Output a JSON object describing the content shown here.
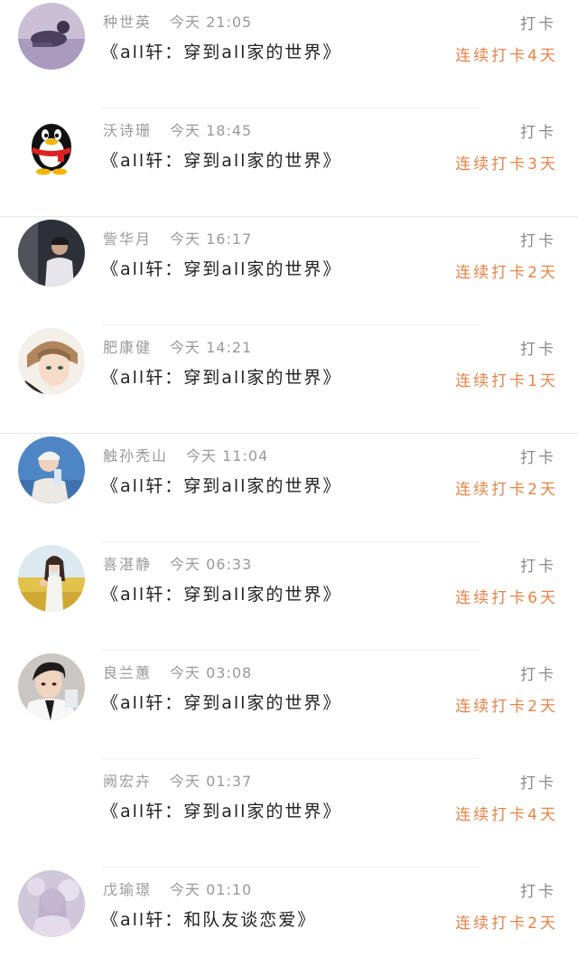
{
  "checkins": [
    {
      "user": "种世英",
      "time": "今天 21:05",
      "book": "《all轩：穿到all家的世界》",
      "action": "打卡",
      "streak": "连续打卡4天",
      "avatar_icon": "purple-photo-avatar-icon"
    },
    {
      "user": "沃诗珊",
      "time": "今天 18:45",
      "book": "《all轩：穿到all家的世界》",
      "action": "打卡",
      "streak": "连续打卡3天",
      "avatar_icon": "qq-penguin-avatar-icon"
    },
    {
      "user": "訾华月",
      "time": "今天 16:17",
      "book": "《all轩：穿到all家的世界》",
      "action": "打卡",
      "streak": "连续打卡2天",
      "avatar_icon": "dark-photo-avatar-icon"
    },
    {
      "user": "肥康健",
      "time": "今天 14:21",
      "book": "《all轩：穿到all家的世界》",
      "action": "打卡",
      "streak": "连续打卡1天",
      "avatar_icon": "anime-boy-avatar-icon"
    },
    {
      "user": "触孙秃山",
      "time": "今天 11:04",
      "book": "《all轩：穿到all家的世界》",
      "action": "打卡",
      "streak": "连续打卡2天",
      "avatar_icon": "blue-photo-avatar-icon"
    },
    {
      "user": "喜湛静",
      "time": "今天 06:33",
      "book": "《all轩：穿到all家的世界》",
      "action": "打卡",
      "streak": "连续打卡6天",
      "avatar_icon": "field-girl-avatar-icon"
    },
    {
      "user": "良兰蕙",
      "time": "今天 03:08",
      "book": "《all轩：穿到all家的世界》",
      "action": "打卡",
      "streak": "连续打卡2天",
      "avatar_icon": "boy-portrait-avatar-icon"
    },
    {
      "user": "阙宏卉",
      "time": "今天 01:37",
      "book": "《all轩：穿到all家的世界》",
      "action": "打卡",
      "streak": "连续打卡4天",
      "avatar_icon": ""
    },
    {
      "user": "戊瑜璟",
      "time": "今天 01:10",
      "book": "《all轩：和队友谈恋爱》",
      "action": "打卡",
      "streak": "连续打卡2天",
      "avatar_icon": "lavender-photo-avatar-icon"
    }
  ],
  "colors": {
    "streak": "#e8834a",
    "meta": "#9a9a9a",
    "title": "#222222"
  }
}
